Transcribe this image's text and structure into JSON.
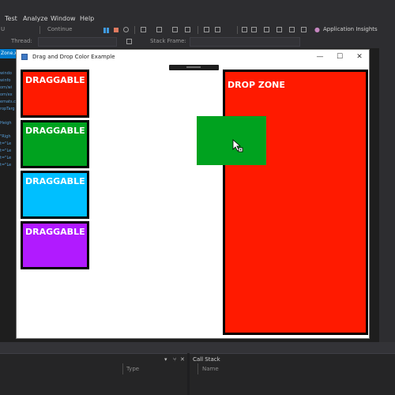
{
  "ide": {
    "menu": [
      "Test",
      "Analyze",
      "Window",
      "Help"
    ],
    "toolbar": {
      "left_text": "U",
      "continue_label": "Continue",
      "app_insights_label": "Application Insights",
      "thread_label": "Thread:",
      "stack_frame_label": "Stack Frame:"
    },
    "editor_tab_label": "Zone.x",
    "code_fragments": [
      "windo",
      "winfo",
      "om/wi",
      "om/ex",
      "emats.c",
      "ropTarg",
      "Heigh",
      "\"Righ",
      "t=\"Le",
      "t=\"Le",
      "t=\"Le",
      "t=\"Le"
    ],
    "bottom": {
      "left_column": "Type",
      "right_title": "Call Stack",
      "right_column": "Name",
      "pin": "▾",
      "dock": "⑂",
      "close": "✕"
    }
  },
  "app": {
    "title": "Drag and Drop Color Example",
    "buttons": {
      "minimize": "—",
      "maximize": "☐",
      "close": "✕"
    },
    "draggables": [
      {
        "label": "DRAGGABLE",
        "color": "#ff1a00"
      },
      {
        "label": "DRAGGABLE",
        "color": "#00a21f"
      },
      {
        "label": "DRAGGABLE",
        "color": "#00bfff"
      },
      {
        "label": "DRAGGABLE",
        "color": "#b11aff"
      }
    ],
    "drop_zone": {
      "label": "DROP ZONE",
      "color": "#ff1a00"
    },
    "drag_ghost": {
      "color": "#00a21f"
    }
  }
}
